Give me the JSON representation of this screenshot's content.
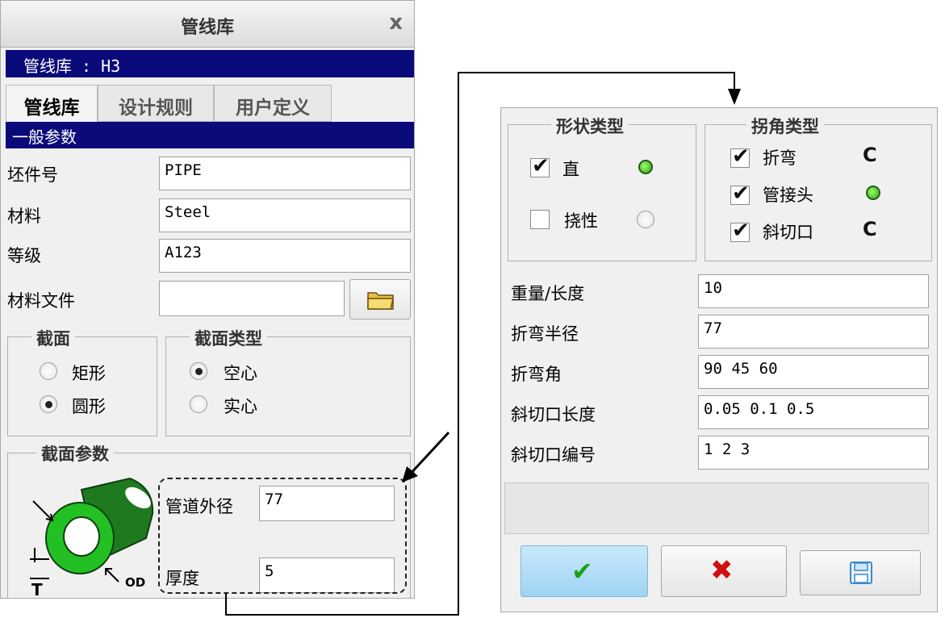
{
  "left_panel": {
    "title": "管线库",
    "close": "x",
    "subtitle": "管线库 : H3",
    "tabs": [
      "管线库",
      "设计规则",
      "用户定义"
    ],
    "section_general": "一般参数",
    "fields": [
      {
        "label": "坯件号",
        "value": "PIPE"
      },
      {
        "label": "材料",
        "value": "Steel"
      },
      {
        "label": "等级",
        "value": "A123"
      },
      {
        "label": "材料文件",
        "value": ""
      }
    ],
    "cross_section": {
      "legend": "截面",
      "options": [
        "矩形",
        "圆形"
      ],
      "selected": "圆形"
    },
    "section_type": {
      "legend": "截面类型",
      "options": [
        "空心",
        "实心"
      ],
      "selected": "空心"
    },
    "section_params": {
      "legend": "截面参数",
      "od_label": "管道外径",
      "od_value": "77",
      "thickness_label": "厚度",
      "thickness_value": "5",
      "diagram_labels": {
        "t": "T",
        "od": "OD"
      }
    }
  },
  "right_panel": {
    "shape_type": {
      "legend": "形状类型",
      "items": [
        {
          "label": "直",
          "checked": true,
          "default": true
        },
        {
          "label": "挠性",
          "checked": false,
          "default": false
        }
      ]
    },
    "corner_type": {
      "legend": "拐角类型",
      "items": [
        {
          "label": "折弯",
          "checked": true,
          "default": false
        },
        {
          "label": "管接头",
          "checked": true,
          "default": true
        },
        {
          "label": "斜切口",
          "checked": true,
          "default": false
        }
      ]
    },
    "params": [
      {
        "label": "重量/长度",
        "value": "10"
      },
      {
        "label": "折弯半径",
        "value": "77"
      },
      {
        "label": "折弯角",
        "value": "90 45 60"
      },
      {
        "label": "斜切口长度",
        "value": "0.05 0.1 0.5"
      },
      {
        "label": "斜切口编号",
        "value": "1 2 3"
      }
    ],
    "buttons": {
      "ok": "✔",
      "cancel": "✖",
      "save": "save"
    }
  },
  "colors": {
    "header_blue": "#0a0a7a",
    "accent_green": "#2ca010",
    "cancel_red": "#d01010"
  }
}
